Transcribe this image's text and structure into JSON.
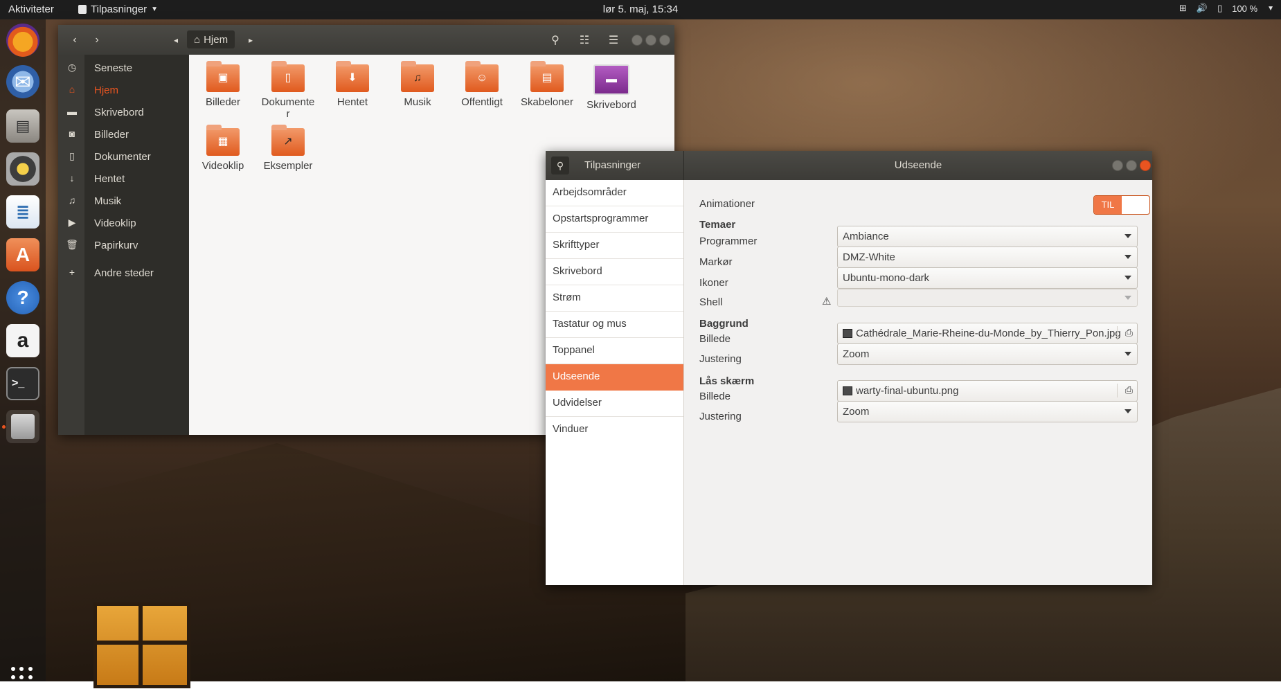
{
  "topbar": {
    "activities": "Aktiviteter",
    "app_menu": "Tilpasninger",
    "clock": "lør  5. maj, 15:34",
    "battery": "100 %"
  },
  "dock": {
    "items": [
      "firefox-icon",
      "thunderbird-icon",
      "files-icon",
      "rhythmbox-icon",
      "writer-icon",
      "software-center-icon",
      "help-icon",
      "amazon-icon",
      "terminal-icon",
      "tweaks-icon"
    ]
  },
  "files": {
    "breadcrumb": "Hjem",
    "sidebar": [
      {
        "label": "Seneste",
        "icon": "clock-icon"
      },
      {
        "label": "Hjem",
        "icon": "home-icon"
      },
      {
        "label": "Skrivebord",
        "icon": "folder-icon"
      },
      {
        "label": "Billeder",
        "icon": "camera-icon"
      },
      {
        "label": "Dokumenter",
        "icon": "document-icon"
      },
      {
        "label": "Hentet",
        "icon": "download-icon"
      },
      {
        "label": "Musik",
        "icon": "music-icon"
      },
      {
        "label": "Videoklip",
        "icon": "video-icon"
      },
      {
        "label": "Papirkurv",
        "icon": "trash-icon"
      },
      {
        "label": "Andre steder",
        "icon": "plus-icon"
      }
    ],
    "folders": [
      {
        "label": "Billeder"
      },
      {
        "label": "Dokumenter"
      },
      {
        "label": "Hentet"
      },
      {
        "label": "Musik"
      },
      {
        "label": "Offentligt"
      },
      {
        "label": "Skabeloner"
      },
      {
        "label": "Skrivebord"
      },
      {
        "label": "Videoklip"
      },
      {
        "label": "Eksempler"
      }
    ]
  },
  "tweaks": {
    "app_title": "Tilpasninger",
    "page_title": "Udseende",
    "sidebar": [
      "Arbejdsområder",
      "Opstartsprogrammer",
      "Skrifttyper",
      "Skrivebord",
      "Strøm",
      "Tastatur og mus",
      "Toppanel",
      "Udseende",
      "Udvidelser",
      "Vinduer"
    ],
    "animations_label": "Animationer",
    "animations_toggle": "TIL",
    "themes_section": "Temaer",
    "programs_label": "Programmer",
    "programs_value": "Ambiance",
    "cursor_label": "Markør",
    "cursor_value": "DMZ-White",
    "icons_label": "Ikoner",
    "icons_value": "Ubuntu-mono-dark",
    "shell_label": "Shell",
    "background_section": "Baggrund",
    "bg_image_label": "Billede",
    "bg_image_value": "Cathédrale_Marie-Rheine-du-Monde_by_Thierry_Pon.jpg",
    "bg_adjust_label": "Justering",
    "bg_adjust_value": "Zoom",
    "lock_section": "Lås skærm",
    "lock_image_label": "Billede",
    "lock_image_value": "warty-final-ubuntu.png",
    "lock_adjust_label": "Justering",
    "lock_adjust_value": "Zoom"
  },
  "colors": {
    "accent": "#e95420",
    "selection": "#f07746",
    "header": "#3c3b37"
  }
}
